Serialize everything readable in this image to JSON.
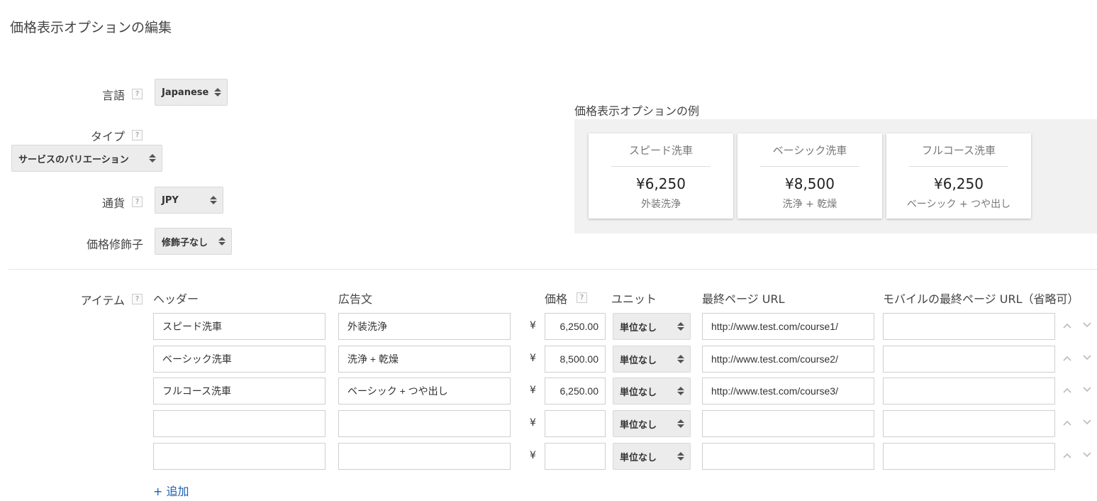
{
  "page": {
    "title": "価格表示オプションの編集"
  },
  "settings": {
    "language": {
      "label": "言語",
      "help": "?",
      "value": "Japanese"
    },
    "type": {
      "label": "タイプ",
      "help": "?",
      "value": "サービスのバリエーション"
    },
    "currency": {
      "label": "通貨",
      "help": "?",
      "value": "JPY"
    },
    "modifier": {
      "label": "価格修飾子",
      "value": "修飾子なし"
    }
  },
  "example": {
    "title": "価格表示オプションの例",
    "cards": [
      {
        "header": "スピード洗車",
        "price": "¥6,250",
        "desc": "外装洗浄"
      },
      {
        "header": "ベーシック洗車",
        "price": "¥8,500",
        "desc": "洗浄 + 乾燥"
      },
      {
        "header": "フルコース洗車",
        "price": "¥6,250",
        "desc": "ベーシック + つや出し"
      }
    ]
  },
  "items": {
    "label": "アイテム",
    "help": "?",
    "columns": {
      "header": "ヘッダー",
      "ad_text": "広告文",
      "price": "価格",
      "price_help": "?",
      "unit": "ユニット",
      "final_url": "最終ページ URL",
      "mobile_url": "モバイルの最終ページ URL（省略可）"
    },
    "currency_symbol": "¥",
    "rows": [
      {
        "header": "スピード洗車",
        "ad_text": "外装洗浄",
        "price": "6,250.00",
        "unit": "単位なし",
        "final_url": "http://www.test.com/course1/",
        "mobile_url": ""
      },
      {
        "header": "ベーシック洗車",
        "ad_text": "洗浄 + 乾燥",
        "price": "8,500.00",
        "unit": "単位なし",
        "final_url": "http://www.test.com/course2/",
        "mobile_url": ""
      },
      {
        "header": "フルコース洗車",
        "ad_text": "ベーシック + つや出し",
        "price": "6,250.00",
        "unit": "単位なし",
        "final_url": "http://www.test.com/course3/",
        "mobile_url": ""
      },
      {
        "header": "",
        "ad_text": "",
        "price": "",
        "unit": "単位なし",
        "final_url": "",
        "mobile_url": ""
      },
      {
        "header": "",
        "ad_text": "",
        "price": "",
        "unit": "単位なし",
        "final_url": "",
        "mobile_url": ""
      }
    ],
    "add_label": "+ 追加",
    "move_up_icon": "chevron-up-icon",
    "move_down_icon": "chevron-down-icon"
  }
}
